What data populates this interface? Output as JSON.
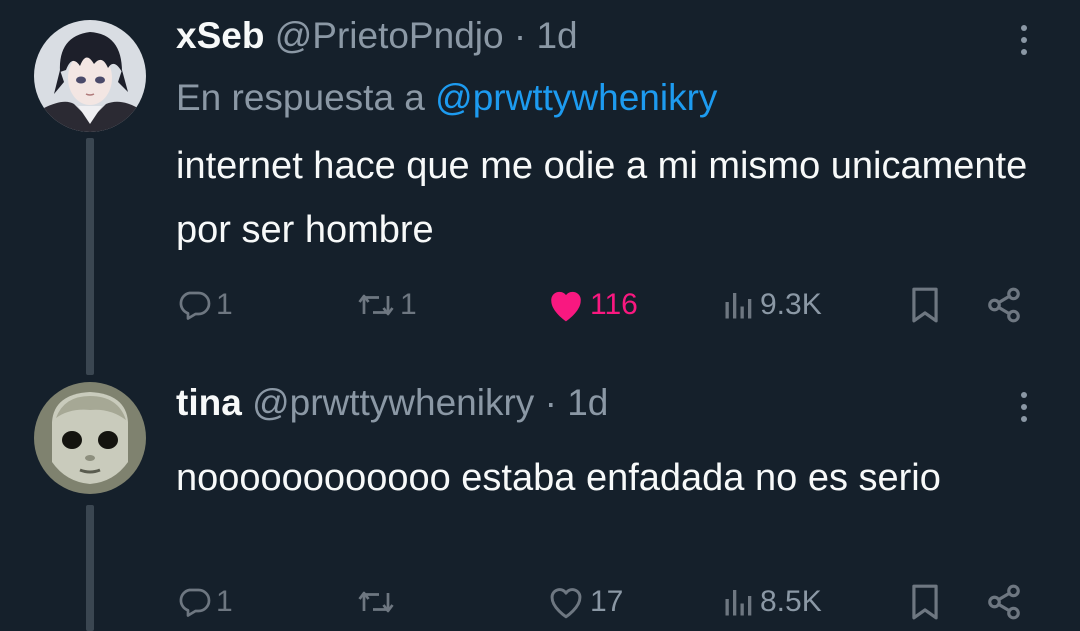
{
  "tweets": [
    {
      "display_name": "xSeb",
      "handle": "@PrietoPndjo",
      "separator": "·",
      "time": "1d",
      "reply_prefix": "En respuesta a",
      "reply_to": "@prwttywhenikry",
      "text": "internet hace que me odie a mi mismo unicamente por ser hombre",
      "replies": "1",
      "retweets": "1",
      "likes": "116",
      "liked": true,
      "views": "9.3K",
      "avatar_icon": "anime-boy-avatar"
    },
    {
      "display_name": "tina",
      "handle": "@prwttywhenikry",
      "separator": "·",
      "time": "1d",
      "text": "noooooooooooo estaba enfadada no es serio",
      "replies": "1",
      "retweets": "",
      "likes": "17",
      "liked": false,
      "views": "8.5K",
      "avatar_icon": "doll-face-avatar"
    }
  ],
  "colors": {
    "background": "#15202b",
    "text": "#f7f9f9",
    "secondary": "#8b98a5",
    "link": "#1d9bf0",
    "like": "#f91880"
  }
}
